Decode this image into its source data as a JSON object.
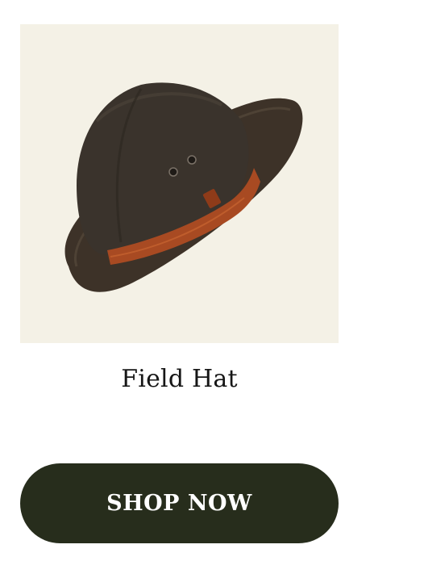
{
  "product": {
    "image_icon": "field-hat-product-photo",
    "image_background": "#f4f1e6",
    "name": "Field Hat"
  },
  "cta": {
    "label": "SHOP NOW",
    "background": "#272d1c",
    "text_color": "#ffffff"
  }
}
